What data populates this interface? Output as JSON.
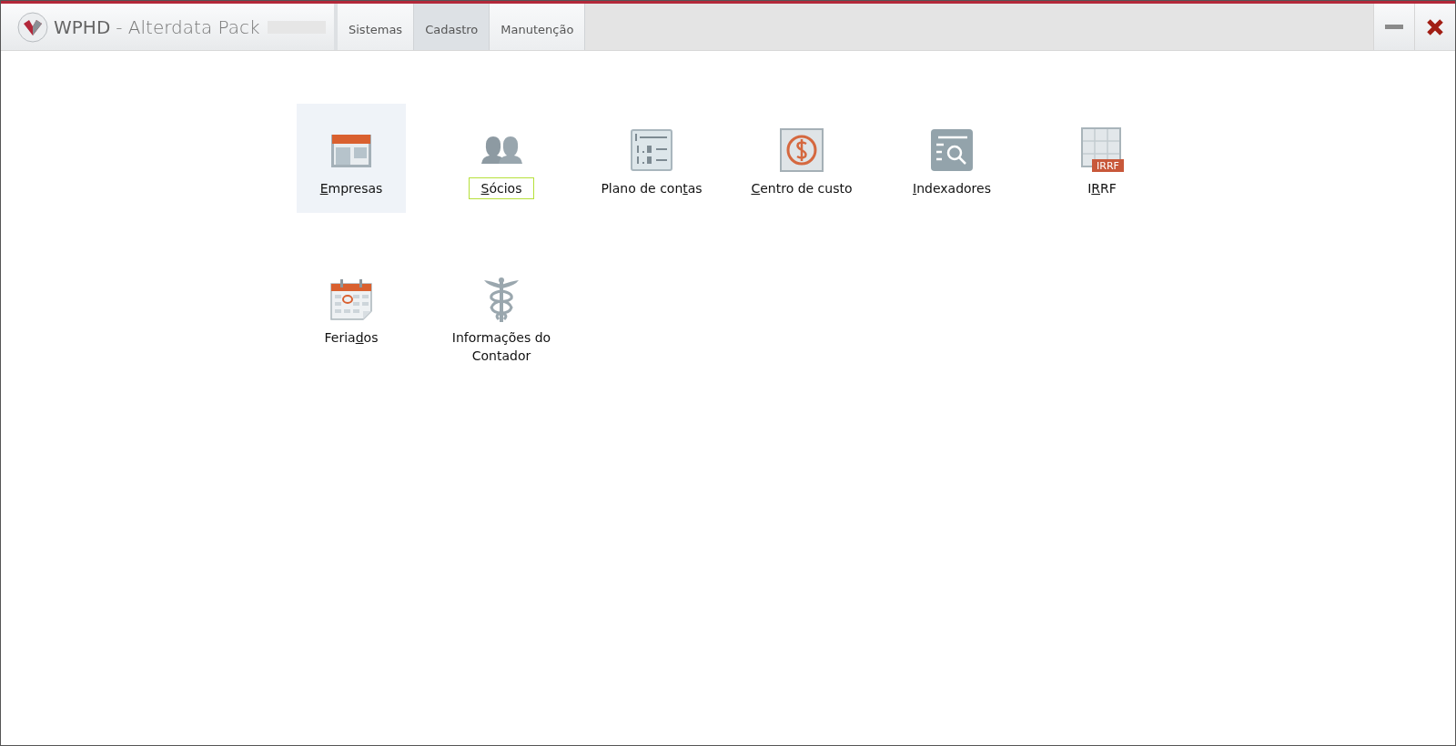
{
  "window": {
    "title_main": "WPHD",
    "title_rest": "- Alterdata Pack"
  },
  "tabs": [
    {
      "label": "Sistemas",
      "selected": false
    },
    {
      "label": "Cadastro",
      "selected": true
    },
    {
      "label": "Manutenção",
      "selected": false
    }
  ],
  "items": [
    {
      "kind": "building",
      "label": {
        "key": "E",
        "post": "mpresas"
      },
      "selected": true,
      "focused": false
    },
    {
      "kind": "people",
      "label": {
        "key": "S",
        "post": "ócios"
      },
      "selected": false,
      "focused": true
    },
    {
      "kind": "list",
      "label": {
        "pre": "Plano de con",
        "key": "t",
        "post": "as"
      },
      "selected": false,
      "focused": false
    },
    {
      "kind": "money",
      "label": {
        "key": "C",
        "post": "entro de custo"
      },
      "selected": false,
      "focused": false
    },
    {
      "kind": "search",
      "label": {
        "key": "I",
        "post": "ndexadores"
      },
      "selected": false,
      "focused": false
    },
    {
      "kind": "table",
      "label": {
        "pre": "I",
        "key": "R",
        "post": "RF"
      },
      "badge": "IRRF",
      "selected": false,
      "focused": false
    },
    {
      "kind": "calendar",
      "label": {
        "pre": "Feria",
        "key": "d",
        "post": "os"
      },
      "selected": false,
      "focused": false
    },
    {
      "kind": "caduceus",
      "label": {
        "pre": "Informações do Contador"
      },
      "selected": false,
      "focused": false
    }
  ]
}
